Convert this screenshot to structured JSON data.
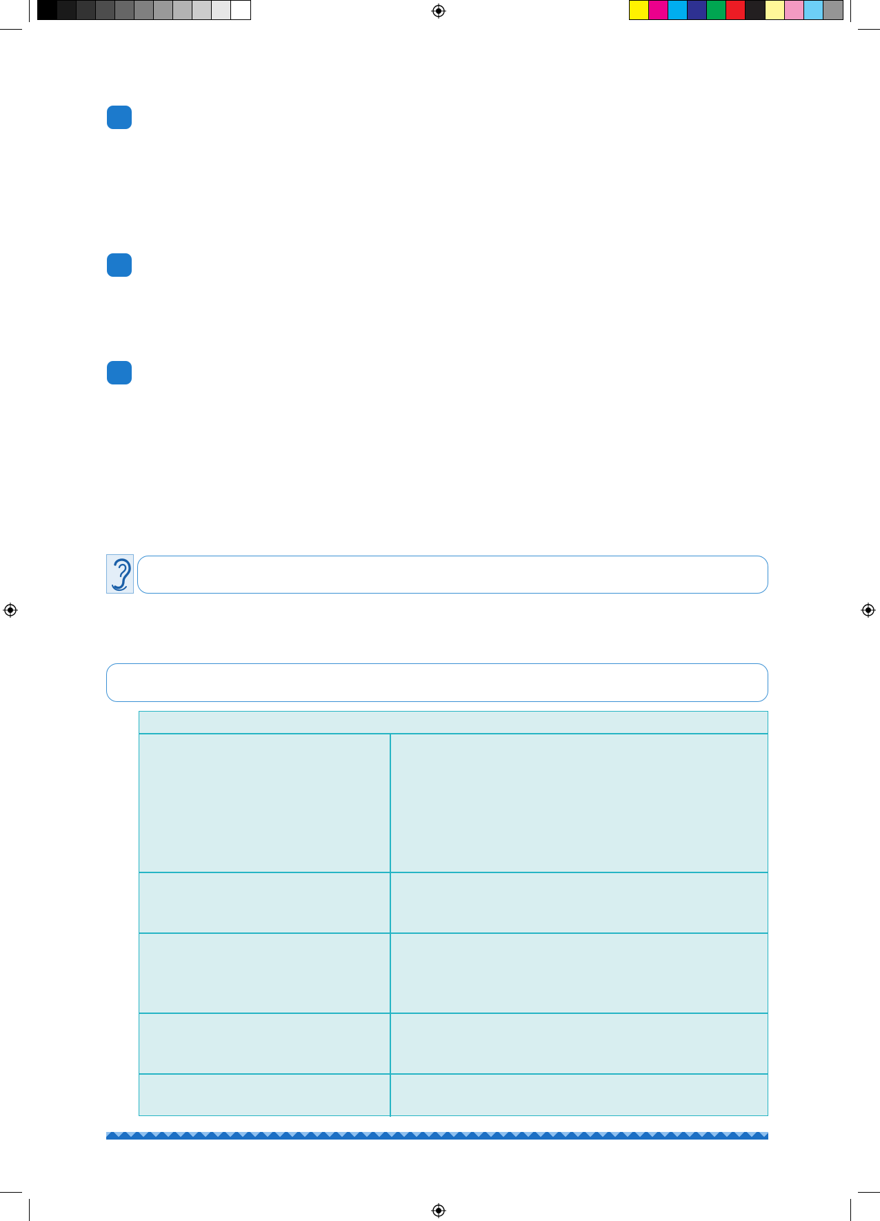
{
  "colors": {
    "accent_blue": "#1c7acc",
    "table_fill": "#d8eef0",
    "table_rule": "#25b4c4",
    "box_rule": "#3a90d4"
  },
  "print_marks": {
    "gray_scale": [
      "#000000",
      "#1a1a1a",
      "#333333",
      "#4d4d4d",
      "#666666",
      "#808080",
      "#999999",
      "#b3b3b3",
      "#cccccc",
      "#e6e6e6",
      "#ffffff"
    ],
    "color_scale": [
      "#fff200",
      "#ec008c",
      "#00aeef",
      "#2e3192",
      "#00a651",
      "#ed1c24",
      "#231f20",
      "#fff799",
      "#f49ac2",
      "#6dcff6",
      "#959595"
    ],
    "registration_icon": "registration-target-icon"
  },
  "icons": {
    "ear": "ear-icon",
    "numbered_marker": "rounded-square-bullet-icon"
  }
}
